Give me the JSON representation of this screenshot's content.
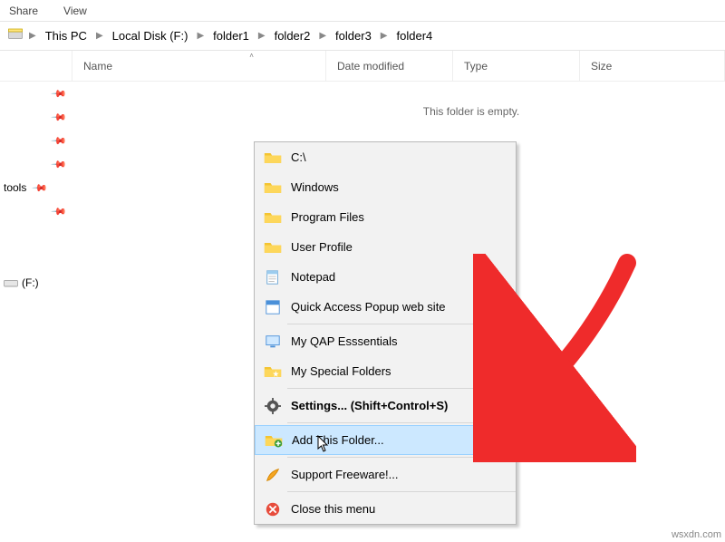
{
  "ribbon": {
    "share": "Share",
    "view": "View"
  },
  "breadcrumb": {
    "items": [
      "This PC",
      "Local Disk (F:)",
      "folder1",
      "folder2",
      "folder3",
      "folder4"
    ]
  },
  "columns": {
    "name": "Name",
    "date": "Date modified",
    "type": "Type",
    "size": "Size"
  },
  "nav": {
    "tools": "tools",
    "drive": " (F:)"
  },
  "empty_msg": "This folder is empty.",
  "ctx": {
    "c_drive": "C:\\",
    "windows": "Windows",
    "program_files": "Program Files",
    "user_profile": "User Profile",
    "notepad": "Notepad",
    "qap_site": "Quick Access Popup web site",
    "essentials": "My QAP Esssentials",
    "special": "My Special Folders",
    "settings": "Settings... (Shift+Control+S)",
    "add_folder": "Add This Folder...",
    "support": "Support Freeware!...",
    "close": "Close this menu"
  },
  "watermark": "wsxdn.com"
}
